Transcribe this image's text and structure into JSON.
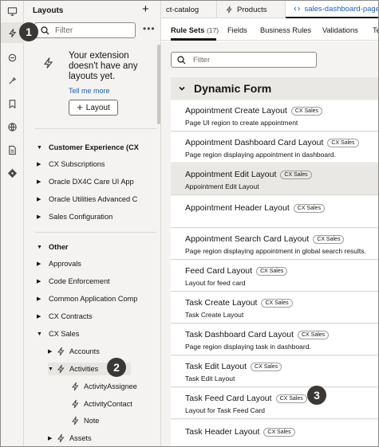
{
  "sidebar": {
    "title": "Layouts",
    "add_icon": "plus-icon",
    "filter_placeholder": "Filter",
    "more_icon": "more-icon",
    "empty_message": "Your extension doesn't have any layouts yet.",
    "tell_me_more": "Tell me more",
    "layout_button": "Layout",
    "tree": [
      {
        "label": "Customer Experience (CX",
        "bold": true,
        "expanded": true
      },
      {
        "label": "CX Subscriptions",
        "expanded": false
      },
      {
        "label": "Oracle DX4C Care UI App",
        "expanded": false
      },
      {
        "label": "Oracle Utilities Advanced C",
        "expanded": false
      },
      {
        "label": "Sales Configuration",
        "expanded": false
      },
      {
        "label": "Other",
        "bold": true,
        "expanded": true
      },
      {
        "label": "Approvals",
        "expanded": false
      },
      {
        "label": "Code Enforcement",
        "expanded": false
      },
      {
        "label": "Common Application Comp",
        "expanded": false
      },
      {
        "label": "CX Contracts",
        "expanded": false
      },
      {
        "label": "CX Sales",
        "expanded": true
      },
      {
        "label": "Accounts",
        "expanded": false
      },
      {
        "label": "Activities",
        "expanded": true
      },
      {
        "label": "ActivityAssignee"
      },
      {
        "label": "ActivityContact"
      },
      {
        "label": "Note"
      },
      {
        "label": "Assets",
        "expanded": false
      }
    ]
  },
  "callouts": [
    "1",
    "2",
    "3"
  ],
  "activity_bar": {
    "icons": [
      "desktop-icon",
      "layouts-icon",
      "events-icon",
      "rules-icon",
      "bookmark-icon",
      "globe-icon",
      "document-icon",
      "git-icon"
    ]
  },
  "tabs": [
    {
      "label": "ct-catalog",
      "icon": ""
    },
    {
      "label": "Products",
      "icon": "lightning-icon"
    },
    {
      "label": "sales-dashboard-page",
      "icon": "code-icon",
      "active": true
    }
  ],
  "subtabs": {
    "rule_sets": "Rule Sets",
    "rule_sets_count": "(17)",
    "fields": "Fields",
    "business_rules": "Business Rules",
    "validations": "Validations",
    "more": "Te"
  },
  "main": {
    "filter_placeholder": "Filter",
    "section_title": "Dynamic Form",
    "cards": [
      {
        "name": "Appointment Create Layout",
        "tag": "CX Sales",
        "desc": "Page UI region to create appointment"
      },
      {
        "name": "Appointment Dashboard Card Layout",
        "tag": "CX Sales",
        "desc": "Page region displaying appointment in dashboard."
      },
      {
        "name": "Appointment Edit Layout",
        "tag": "CX Sales",
        "desc": "Appointment Edit Layout",
        "selected": true
      },
      {
        "name": "Appointment Header Layout",
        "tag": "CX Sales",
        "desc": ""
      },
      {
        "name": "Appointment Search Card Layout",
        "tag": "CX Sales",
        "desc": "Page region displaying appointment in global search results."
      },
      {
        "name": "Feed Card Layout",
        "tag": "CX Sales",
        "desc": "Layout for feed card"
      },
      {
        "name": "Task Create Layout",
        "tag": "CX Sales",
        "desc": "Task Create Layout"
      },
      {
        "name": "Task Dashboard Card Layout",
        "tag": "CX Sales",
        "desc": "Page region displaying task in dashboard."
      },
      {
        "name": "Task Edit Layout",
        "tag": "CX Sales",
        "desc": "Task Edit Layout"
      },
      {
        "name": "Task Feed Card Layout",
        "tag": "CX Sales",
        "desc": "Layout for Task Feed Card"
      },
      {
        "name": "Task Header Layout",
        "tag": "CX Sales",
        "desc": ""
      }
    ]
  }
}
